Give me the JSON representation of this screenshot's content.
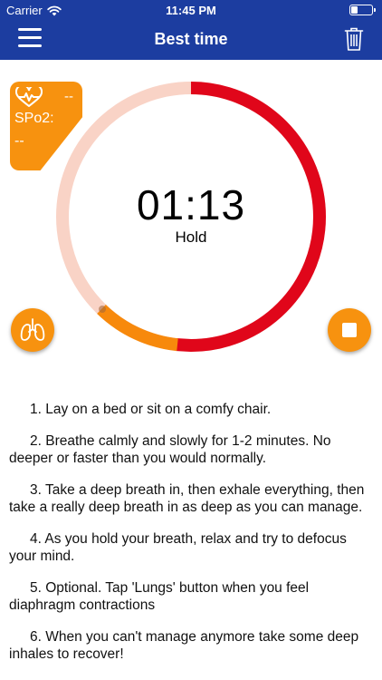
{
  "status_bar": {
    "carrier": "Carrier",
    "time": "11:45 PM"
  },
  "nav": {
    "title": "Best time",
    "bar_color": "#1c3da0"
  },
  "sensor": {
    "heart_rate": "--",
    "spo2_label": "SPo2:",
    "spo2_value": "--"
  },
  "timer": {
    "display": "01:13",
    "phase": "Hold",
    "colors": {
      "track": "#f9d3c6",
      "progress": "#e0061a",
      "secondary": "#f7890c",
      "accent": "#f7920f"
    }
  },
  "instructions": [
    "1. Lay on a bed or sit on a comfy chair.",
    "2. Breathe calmly and slowly for 1-2 minutes. No deeper or faster than you would normally.",
    "3. Take a deep breath in, then exhale everything, then take a really deep breath in as deep as you can manage.",
    "4. As you hold your breath, relax and try to defocus your mind.",
    "5. Optional. Tap 'Lungs' button when you feel diaphragm contractions",
    "6. When you can't manage anymore take some deep inhales to recover!"
  ]
}
